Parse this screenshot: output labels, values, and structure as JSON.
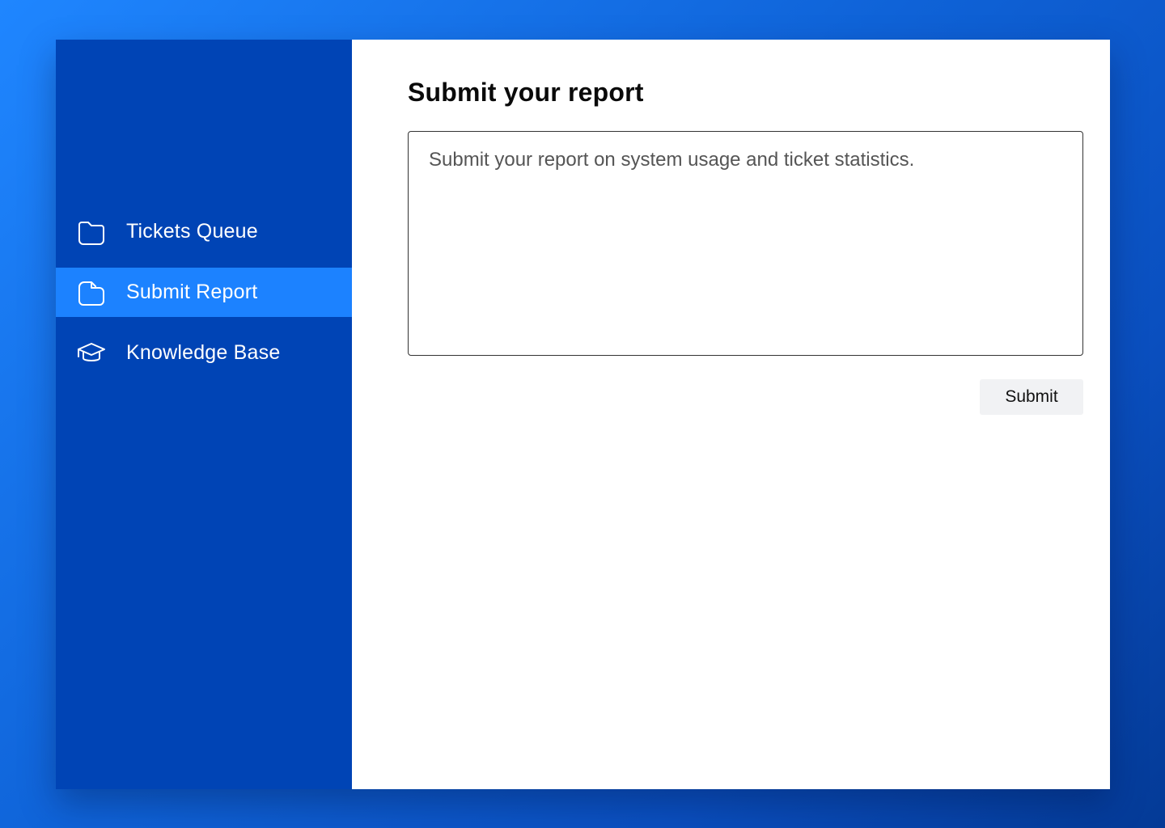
{
  "theme": {
    "sidebar_bg": "#0044b5",
    "active_item_bg": "#1c82ff",
    "background_gradient_start": "#1f86ff",
    "background_gradient_end": "#043a96",
    "content_bg": "#ffffff",
    "button_bg": "#f1f2f4"
  },
  "sidebar": {
    "items": [
      {
        "label": "Tickets Queue",
        "icon": "folder-icon",
        "active": false
      },
      {
        "label": "Submit Report",
        "icon": "document-icon",
        "active": true
      },
      {
        "label": "Knowledge Base",
        "icon": "graduation-cap-icon",
        "active": false
      }
    ]
  },
  "main": {
    "title": "Submit your report",
    "report_field": {
      "placeholder": "Submit your report on system usage and ticket statistics.",
      "value": ""
    },
    "submit_label": "Submit"
  }
}
